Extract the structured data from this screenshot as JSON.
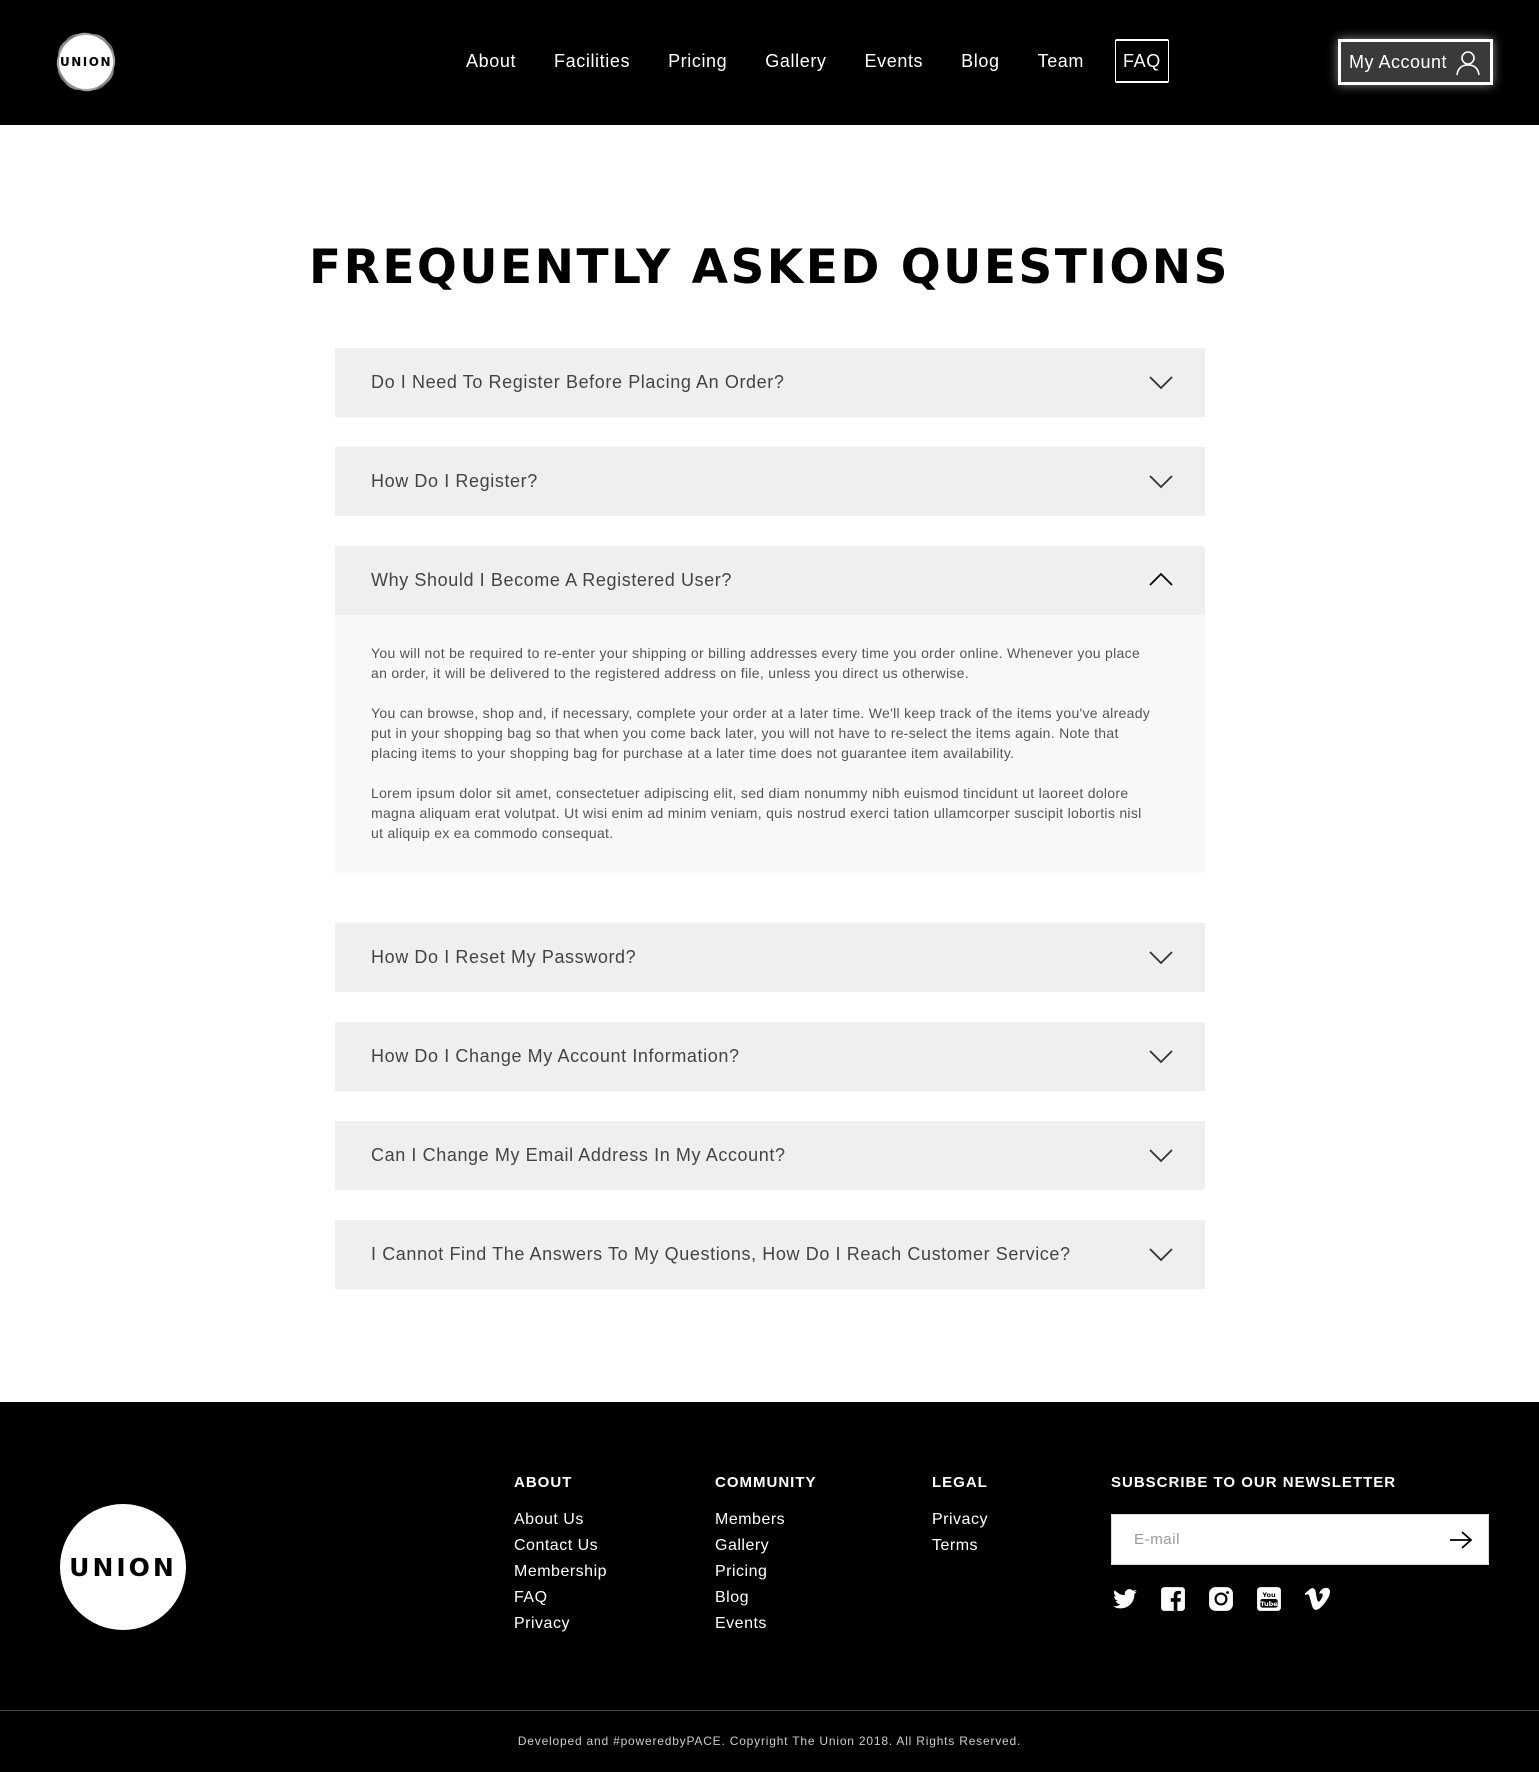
{
  "header": {
    "logo_text": "UNION",
    "nav": [
      {
        "label": "About"
      },
      {
        "label": "Facilities"
      },
      {
        "label": "Pricing"
      },
      {
        "label": "Gallery"
      },
      {
        "label": "Events"
      },
      {
        "label": "Blog"
      },
      {
        "label": "Team"
      },
      {
        "label": "FAQ",
        "active": true
      }
    ],
    "account_label": "My Account"
  },
  "main": {
    "title": "FREQUENTLY ASKED QUESTIONS",
    "faqs": [
      {
        "question": "Do I Need To Register Before Placing An Order?",
        "expanded": false
      },
      {
        "question": "How Do I Register?",
        "expanded": false
      },
      {
        "question": "Why Should I Become A Registered User?",
        "expanded": true,
        "answer": [
          "You will not be required to re-enter your shipping or billing addresses every time you order online. Whenever you place an order, it will be delivered to the registered address on file, unless you direct us otherwise.",
          "You can browse, shop and, if necessary, complete your order at a later time. We'll keep track of the items you've already put in your shopping bag so that when you come back later, you will not have to re-select the items again. Note that placing items to your shopping bag for purchase at a later time does not guarantee item availability.",
          "Lorem ipsum dolor sit amet, consectetuer adipiscing elit, sed diam nonummy nibh euismod tincidunt ut laoreet dolore magna aliquam erat volutpat. Ut wisi enim ad minim veniam, quis nostrud exerci tation ullamcorper suscipit lobortis nisl ut aliquip ex ea commodo consequat."
        ]
      },
      {
        "question": "How Do I Reset My Password?",
        "expanded": false
      },
      {
        "question": "How Do I Change My Account Information?",
        "expanded": false
      },
      {
        "question": "Can I Change My Email Address In My Account?",
        "expanded": false
      },
      {
        "question": "I Cannot Find The Answers To My Questions, How Do I Reach Customer Service?",
        "expanded": false
      }
    ]
  },
  "footer": {
    "logo_text": "UNION",
    "columns": [
      {
        "heading": "ABOUT",
        "links": [
          "About Us",
          "Contact Us",
          "Membership",
          "FAQ",
          "Privacy"
        ]
      },
      {
        "heading": "COMMUNITY",
        "links": [
          "Members",
          "Gallery",
          "Pricing",
          "Blog",
          "Events"
        ]
      },
      {
        "heading": "LEGAL",
        "links": [
          "Privacy",
          "Terms"
        ]
      }
    ],
    "newsletter": {
      "heading": "SUBSCRIBE TO OUR NEWSLETTER",
      "placeholder": "E-mail"
    },
    "socials": [
      "twitter-icon",
      "facebook-icon",
      "instagram-icon",
      "youtube-icon",
      "vimeo-icon"
    ],
    "copyright": "Developed and #poweredbyPACE. Copyright The Union 2018. All Rights Reserved."
  },
  "colors": {
    "header_bg": "#000000",
    "faq_bg": "#efefef",
    "answer_bg": "#f8f8f8",
    "footer_bg": "#000000"
  }
}
